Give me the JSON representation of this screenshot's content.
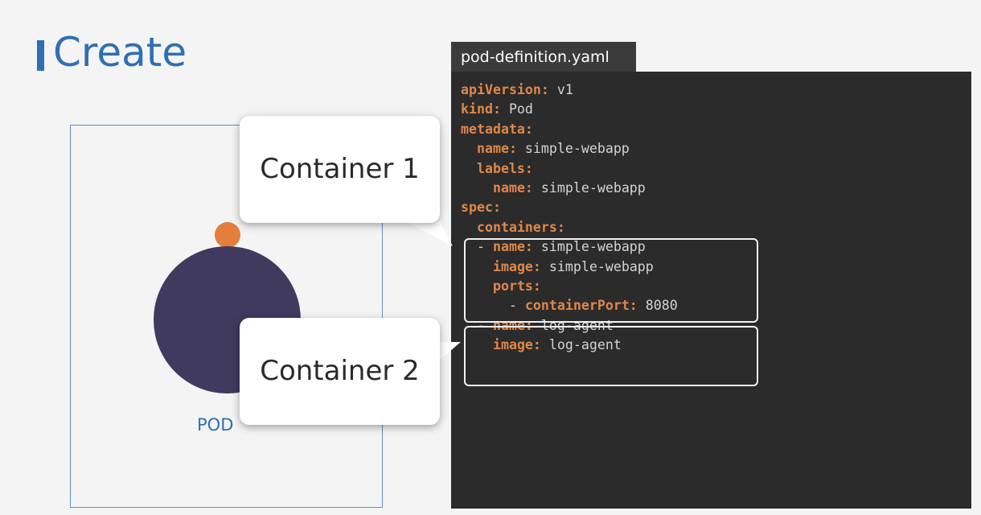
{
  "slide": {
    "title": "Create"
  },
  "pod": {
    "label": "POD"
  },
  "editor": {
    "filename": "pod-definition.yaml",
    "lines": [
      {
        "indent": "",
        "key": "apiVersion:",
        "value": " v1"
      },
      {
        "indent": "",
        "key": "kind:",
        "value": " Pod"
      },
      {
        "indent": "",
        "key": "metadata:",
        "value": ""
      },
      {
        "indent": "  ",
        "key": "name:",
        "value": " simple-webapp"
      },
      {
        "indent": "  ",
        "key": "labels:",
        "value": ""
      },
      {
        "indent": "    ",
        "key": "name:",
        "value": " simple-webapp"
      },
      {
        "indent": "",
        "key": "spec:",
        "value": ""
      },
      {
        "indent": "  ",
        "key": "containers:",
        "value": ""
      },
      {
        "indent": "  - ",
        "key": "name:",
        "value": " simple-webapp"
      },
      {
        "indent": "    ",
        "key": "image:",
        "value": " simple-webapp"
      },
      {
        "indent": "    ",
        "key": "ports:",
        "value": ""
      },
      {
        "indent": "      - ",
        "key": "containerPort:",
        "value": " 8080"
      },
      {
        "indent": "  - ",
        "key": "name:",
        "value": " log-agent"
      },
      {
        "indent": "    ",
        "key": "image:",
        "value": " log-agent"
      }
    ]
  },
  "callouts": {
    "container1": "Container 1",
    "container2": "Container 2"
  },
  "colors": {
    "title_blue": "#2e6fb5",
    "yaml_key_orange": "#e0874a",
    "pod_purple": "#3f3a5e",
    "pod_dot_orange": "#e47e3c",
    "editor_bg": "#2b2b2b"
  }
}
